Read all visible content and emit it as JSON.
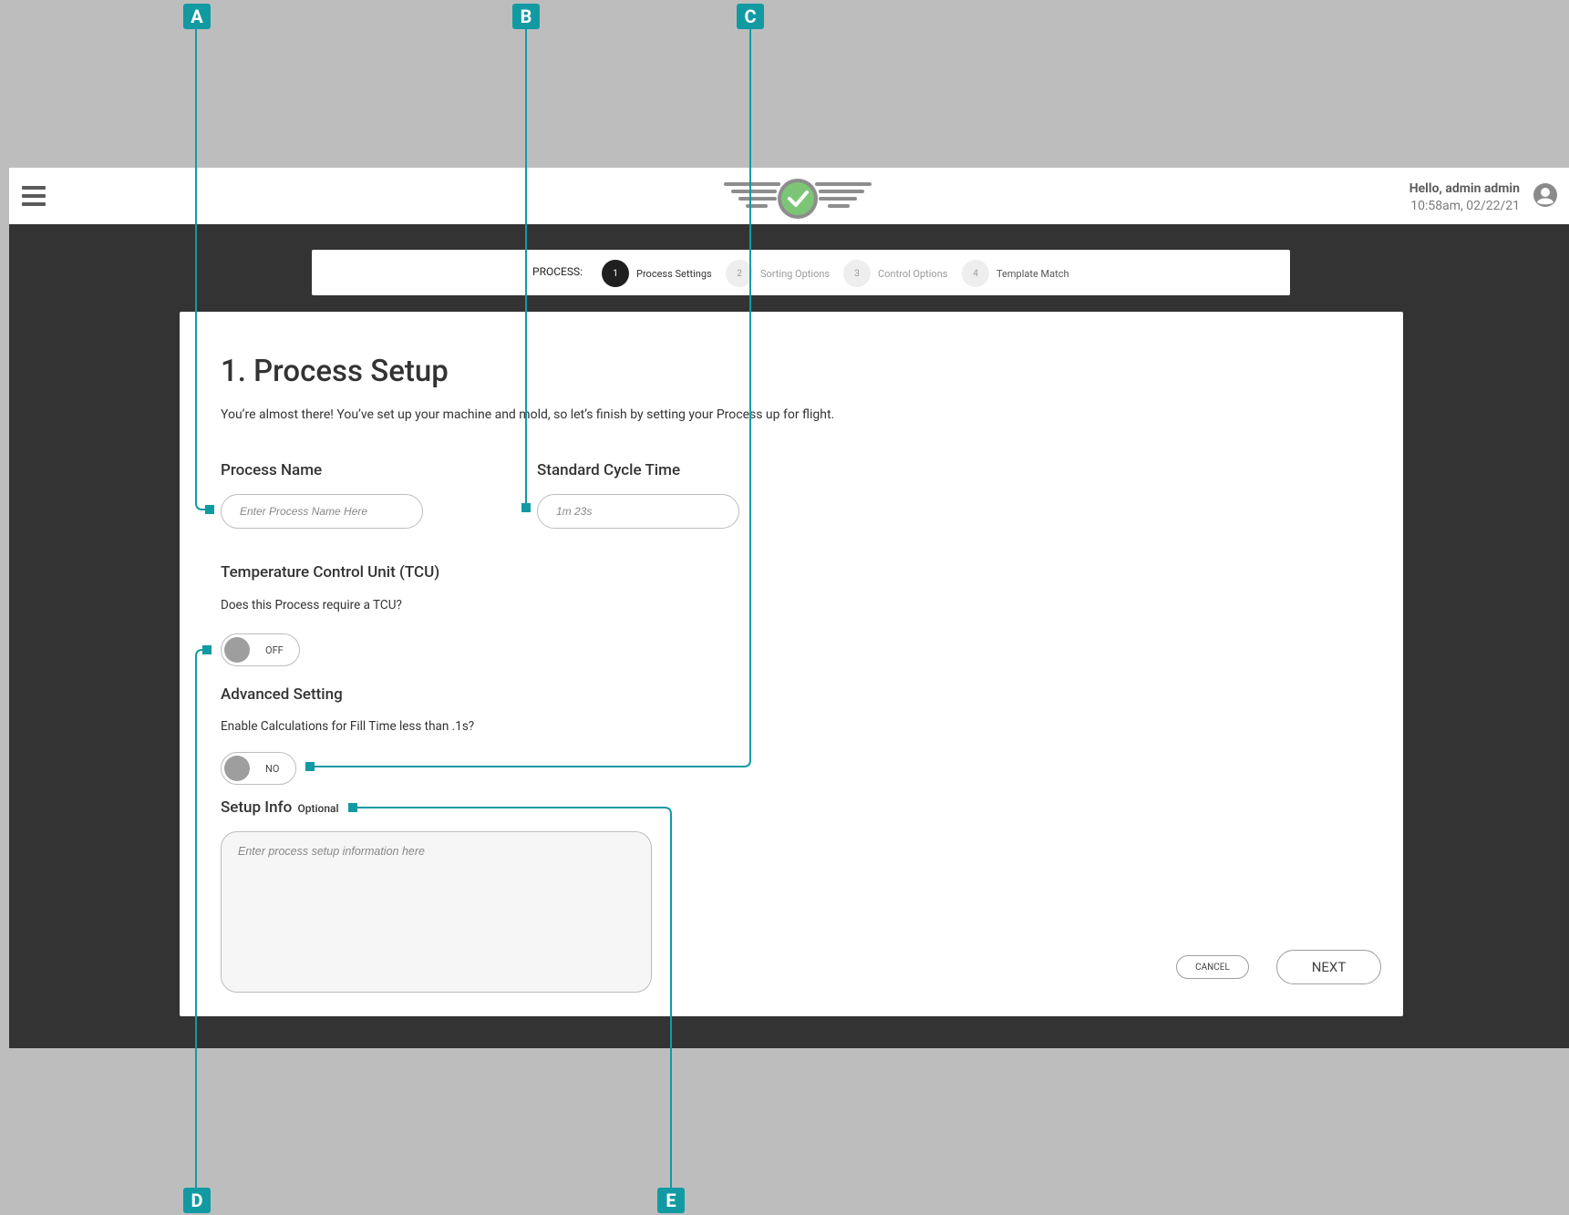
{
  "header": {
    "greeting": "Hello, admin admin",
    "timestamp": "10:58am, 02/22/21"
  },
  "stepper": {
    "label": "PROCESS:",
    "steps": [
      {
        "number": "1",
        "label": "Process Settings",
        "state": "active"
      },
      {
        "number": "2",
        "label": "Sorting Options",
        "state": "inactive"
      },
      {
        "number": "3",
        "label": "Control Options",
        "state": "inactive"
      },
      {
        "number": "4",
        "label": "Template Match",
        "state": "inactive"
      }
    ]
  },
  "form": {
    "title": "1. Process Setup",
    "subtitle": "You’re almost there! You’ve set up your machine and mold, so let’s finish by setting your Process up for flight.",
    "process_name": {
      "label": "Process Name",
      "placeholder": "Enter Process Name Here"
    },
    "cycle_time": {
      "label": "Standard Cycle Time",
      "placeholder": "1m 23s"
    },
    "tcu": {
      "heading": "Temperature Control Unit (TCU)",
      "question": "Does this Process require a TCU?",
      "toggle_state": "OFF"
    },
    "advanced": {
      "heading": "Advanced Setting",
      "question": "Enable Calculations for Fill Time less than .1s?",
      "toggle_state": "NO"
    },
    "setup_info": {
      "label": "Setup Info",
      "optional": "Optional",
      "placeholder": "Enter process setup information here"
    },
    "cancel_label": "CANCEL",
    "next_label": "NEXT"
  },
  "callouts": {
    "a": "A",
    "b": "B",
    "c": "C",
    "d": "D",
    "e": "E"
  },
  "colors": {
    "accent": "#129aa3",
    "page_bg": "#bdbdbd",
    "app_bg": "#333333",
    "logo_green": "#7cc576",
    "logo_gray": "#8d8d8d"
  },
  "icons": {
    "menu": "hamburger-icon",
    "user": "user-circle-icon",
    "logo": "winged-check-logo"
  }
}
